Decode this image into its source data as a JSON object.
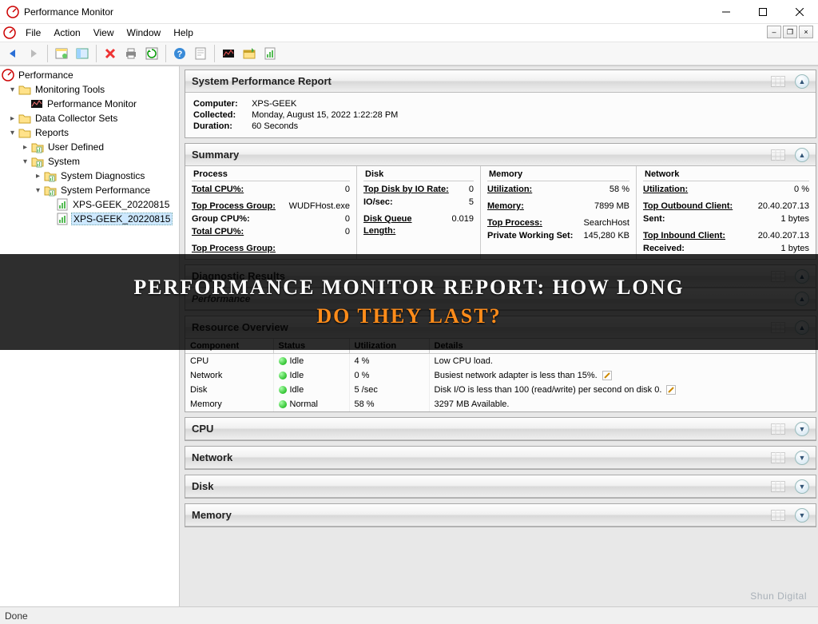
{
  "window": {
    "title": "Performance Monitor"
  },
  "menu": {
    "file": "File",
    "action": "Action",
    "view": "View",
    "window": "Window",
    "help": "Help"
  },
  "tree": {
    "root": "Performance",
    "monitoring_tools": "Monitoring Tools",
    "perfmon": "Performance Monitor",
    "data_collector": "Data Collector Sets",
    "reports": "Reports",
    "user_defined": "User Defined",
    "system": "System",
    "sys_diag": "System Diagnostics",
    "sys_perf": "System Performance",
    "item1": "XPS-GEEK_20220815",
    "item2": "XPS-GEEK_20220815"
  },
  "report": {
    "title": "System Performance Report",
    "computer_label": "Computer:",
    "computer": "XPS-GEEK",
    "collected_label": "Collected:",
    "collected": "Monday, August 15, 2022 1:22:28 PM",
    "duration_label": "Duration:",
    "duration": "60 Seconds"
  },
  "summary": {
    "title": "Summary",
    "process": {
      "heading": "Process",
      "total_cpu_lbl": "Total CPU%:",
      "total_cpu": "0",
      "top_group_lbl": "Top Process Group:",
      "top_group": "WUDFHost.exe",
      "group_cpu_lbl": "Group CPU%:",
      "group_cpu": "0",
      "total_cpu2_lbl": "Total CPU%:",
      "total_cpu2": "0",
      "top_group2_lbl": "Top Process Group:"
    },
    "disk": {
      "heading": "Disk",
      "top_io_lbl": "Top Disk by IO Rate:",
      "top_io": "0",
      "iosec_lbl": "IO/sec:",
      "iosec": "5",
      "queue_lbl": "Disk Queue Length:",
      "queue": "0.019"
    },
    "memory": {
      "heading": "Memory",
      "util_lbl": "Utilization:",
      "util": "58 %",
      "mem_lbl": "Memory:",
      "mem": "7899 MB",
      "top_proc_lbl": "Top Process:",
      "top_proc": "SearchHost",
      "pws_lbl": "Private Working Set:",
      "pws": "145,280 KB"
    },
    "network": {
      "heading": "Network",
      "util_lbl": "Utilization:",
      "util": "0 %",
      "out_lbl": "Top Outbound Client:",
      "out": "20.40.207.13",
      "sent_lbl": "Sent:",
      "sent": "1 bytes",
      "in_lbl": "Top Inbound Client:",
      "in": "20.40.207.13",
      "recv_lbl": "Received:",
      "recv": "1 bytes"
    }
  },
  "diag": {
    "title": "Diagnostic Results",
    "perf": "Performance"
  },
  "resources": {
    "title": "Resource Overview",
    "headers": {
      "comp": "Component",
      "status": "Status",
      "util": "Utilization",
      "details": "Details"
    },
    "rows": [
      {
        "comp": "CPU",
        "status": "Idle",
        "util": "4 %",
        "details": "Low CPU load."
      },
      {
        "comp": "Network",
        "status": "Idle",
        "util": "0 %",
        "details": "Busiest network adapter is less than 15%.",
        "edit": true
      },
      {
        "comp": "Disk",
        "status": "Idle",
        "util": "5 /sec",
        "details": "Disk I/O is less than 100 (read/write) per second on disk 0.",
        "edit": true
      },
      {
        "comp": "Memory",
        "status": "Normal",
        "util": "58 %",
        "details": "3297 MB Available."
      }
    ]
  },
  "collapsed": {
    "cpu": "CPU",
    "network": "Network",
    "disk": "Disk",
    "memory": "Memory"
  },
  "status": "Done",
  "overlay": {
    "line1": "PERFORMANCE MONITOR REPORT: HOW LONG",
    "line2": "DO THEY LAST?"
  },
  "watermark": "Shun Digital"
}
